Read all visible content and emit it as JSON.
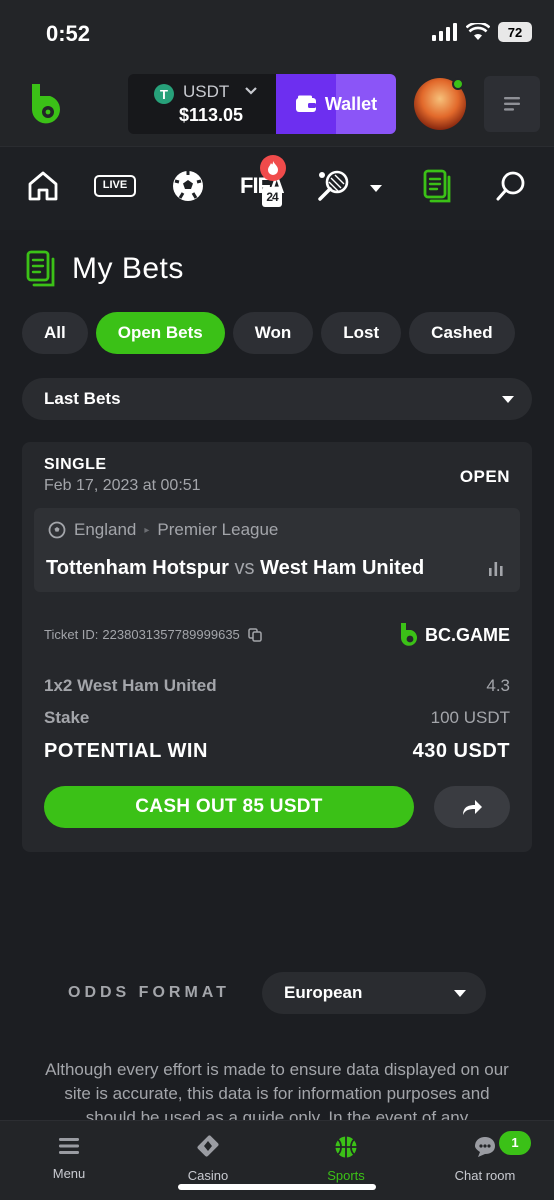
{
  "status_bar": {
    "time": "0:52",
    "battery": "72"
  },
  "header": {
    "currency": "USDT",
    "balance": "$113.05",
    "wallet_label": "Wallet"
  },
  "sport_nav": {
    "items": [
      "home-icon",
      "live-icon",
      "soccer-icon",
      "fifa-icon",
      "tennis-icon",
      "my-bets-icon",
      "search-icon"
    ],
    "live_label": "LIVE",
    "fifa_label": "FIFA",
    "fifa_year": "24"
  },
  "page": {
    "title": "My Bets"
  },
  "filters": [
    {
      "label": "All",
      "active": false
    },
    {
      "label": "Open Bets",
      "active": true
    },
    {
      "label": "Won",
      "active": false
    },
    {
      "label": "Lost",
      "active": false
    },
    {
      "label": "Cashed",
      "active": false
    }
  ],
  "period_select": {
    "value": "Last Bets"
  },
  "bet": {
    "type": "SINGLE",
    "date": "Feb 17, 2023 at 00:51",
    "status": "OPEN",
    "country": "England",
    "league": "Premier League",
    "home_team": "Tottenham Hotspur",
    "vs": "vs",
    "away_team": "West Ham United",
    "ticket_label": "Ticket ID:",
    "ticket_id": "2238031357789999635",
    "brand": "BC.GAME",
    "selection": "1x2 West Ham United",
    "odds": "4.3",
    "stake_label": "Stake",
    "stake": "100 USDT",
    "potential_label": "POTENTIAL WIN",
    "potential_win": "430 USDT",
    "cashout_label": "CASH OUT 85 USDT"
  },
  "odds_format": {
    "label": "ODDS FORMAT",
    "value": "European"
  },
  "disclaimer": "Although every effort is made to ensure data displayed on our site is accurate, this data is for information purposes and should be used as a guide only. In the event of any",
  "bottom_nav": {
    "items": [
      {
        "label": "Menu",
        "icon": "menu-icon"
      },
      {
        "label": "Casino",
        "icon": "casino-icon"
      },
      {
        "label": "Sports",
        "icon": "basketball-icon",
        "active": true
      },
      {
        "label": "Chat room",
        "icon": "chat-icon"
      }
    ],
    "chat_badge": "1"
  },
  "colors": {
    "accent": "#3bc117",
    "wallet": "#6d2ff0",
    "background": "#1c1e22"
  }
}
